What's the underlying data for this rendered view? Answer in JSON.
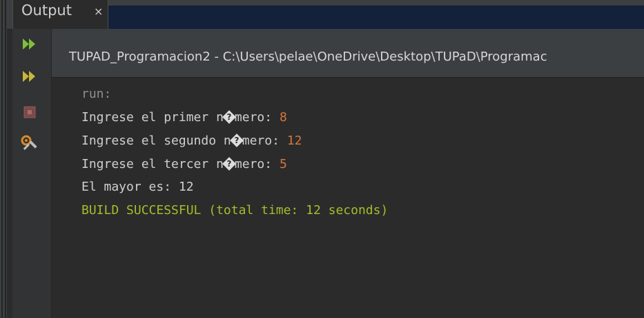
{
  "tab": {
    "label": "Output",
    "close_glyph": "×"
  },
  "toolbar": [
    {
      "name": "rerun-icon",
      "title": "Re-run"
    },
    {
      "name": "rerun-with-params-icon",
      "title": "Re-run with different parameters"
    },
    {
      "name": "stop-icon",
      "title": "Stop"
    },
    {
      "name": "settings-icon",
      "title": "Settings"
    }
  ],
  "path_header": "TUPAD_Programacion2 - C:\\Users\\pelae\\OneDrive\\Desktop\\TUPaD\\Programac",
  "console": {
    "run_label": "run:",
    "lines": [
      {
        "prefix": "Ingrese el primer n",
        "suffix": "mero: ",
        "input": "8"
      },
      {
        "prefix": "Ingrese el segundo n",
        "suffix": "mero: ",
        "input": "12"
      },
      {
        "prefix": "Ingrese el tercer n",
        "suffix": "mero: ",
        "input": "5"
      }
    ],
    "replacement_glyph": "?",
    "result": "El mayor es: 12",
    "build_status": "BUILD SUCCESSFUL (total time: 12 seconds)"
  },
  "colors": {
    "background": "#2b2b2b",
    "user_input": "#d4773b",
    "success": "#a4bd2c",
    "run_icon": "#7fbf3a"
  }
}
